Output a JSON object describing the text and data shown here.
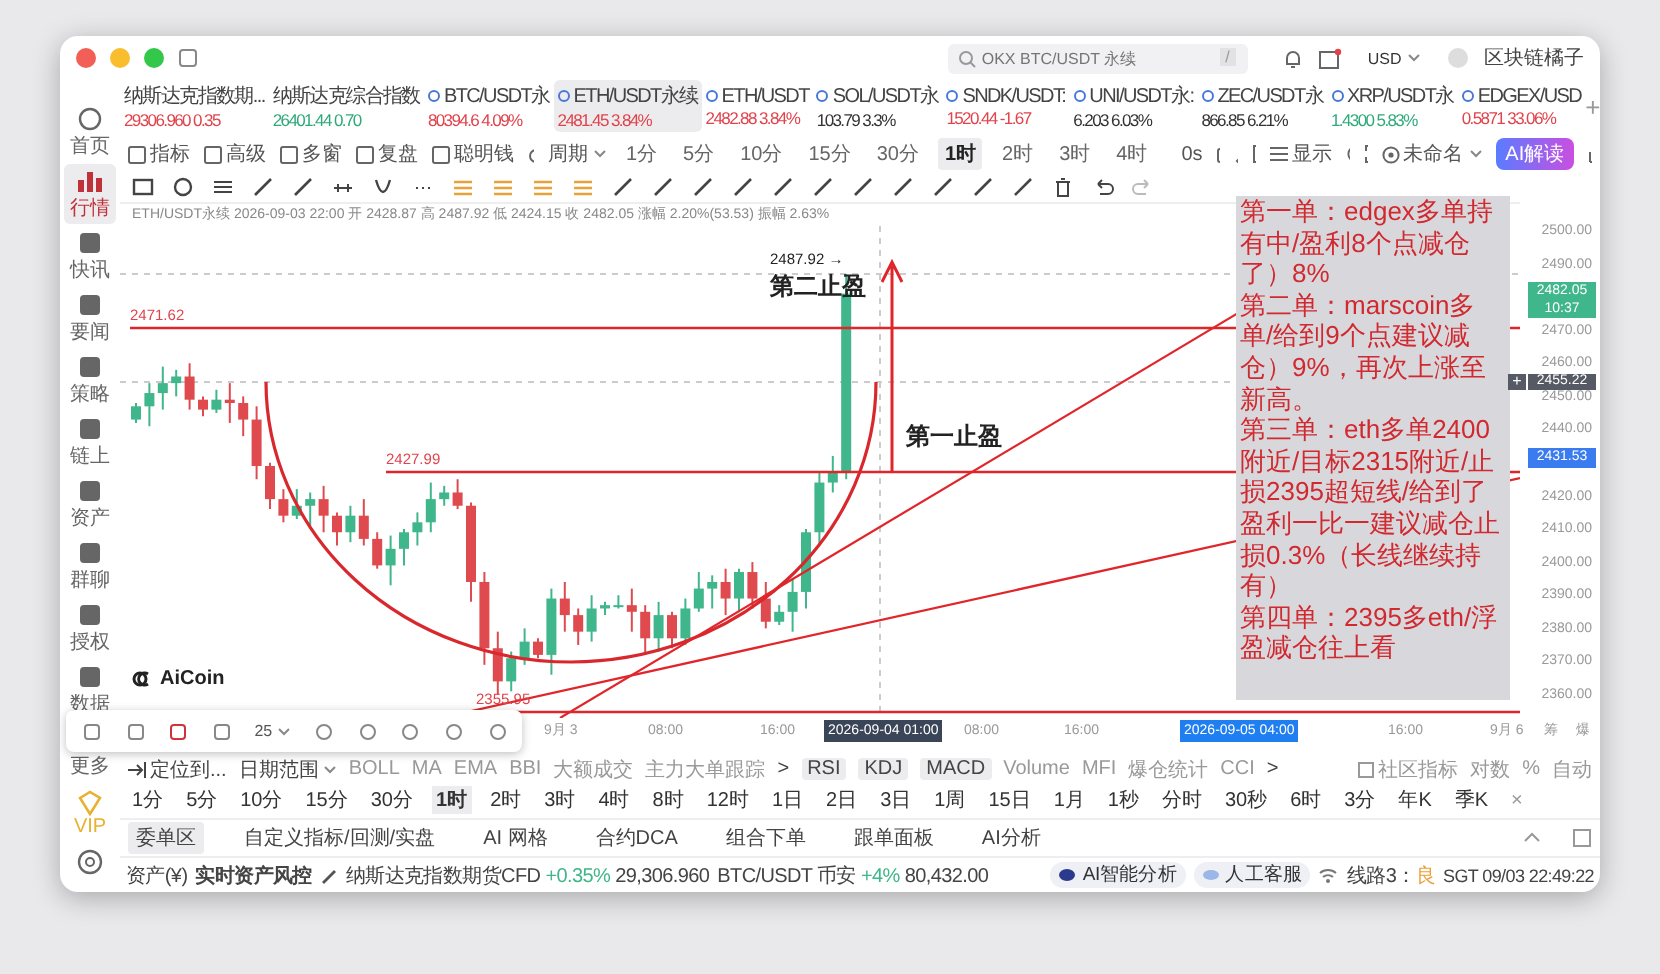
{
  "titlebar": {
    "search_placeholder": "OKX BTC/USDT 永续",
    "search_shortcut": "/",
    "currency": "USD",
    "user": "区块链橘子"
  },
  "sidebar": {
    "items": [
      {
        "kind": "home",
        "label": "首页",
        "selected": false
      },
      {
        "kind": "market",
        "label": "行情",
        "selected": true
      },
      {
        "kind": "flash",
        "label": "快讯",
        "selected": false
      },
      {
        "kind": "news",
        "label": "要闻",
        "selected": false
      },
      {
        "kind": "bot",
        "label": "策略",
        "selected": false
      },
      {
        "kind": "chain",
        "label": "链上",
        "selected": false
      },
      {
        "kind": "wallet",
        "label": "资产",
        "selected": false
      },
      {
        "kind": "chat",
        "label": "群聊",
        "selected": false
      },
      {
        "kind": "auth",
        "label": "授权",
        "selected": false
      },
      {
        "kind": "data",
        "label": "数据",
        "selected": false
      },
      {
        "kind": "more",
        "label": "更多",
        "selected": false
      },
      {
        "kind": "vip",
        "label": "VIP",
        "selected": false
      }
    ]
  },
  "tickers": [
    {
      "name": "纳斯达克指数期...",
      "price": "29306.960",
      "change": "0.35",
      "color": "#e0434b",
      "dot": false,
      "selected": false
    },
    {
      "name": "纳斯达克综合指数",
      "price": "26401.44",
      "change": "0.70",
      "color": "#2fa97c",
      "dot": false,
      "selected": false
    },
    {
      "name": "BTC/USDT永",
      "price": "80394.6",
      "change": "4.09%",
      "color": "#e0434b",
      "dot": true,
      "selected": false
    },
    {
      "name": "ETH/USDT永续",
      "price": "2481.45",
      "change": "3.84%",
      "color": "#e0434b",
      "dot": true,
      "selected": true
    },
    {
      "name": "ETH/USDT",
      "price": "2482.88",
      "change": "3.84%",
      "color": "#e0434b",
      "dot": true,
      "selected": false
    },
    {
      "name": "SOL/USDT永",
      "price": "103.79",
      "change": "3.3%",
      "color": "#333333",
      "dot": true,
      "selected": false
    },
    {
      "name": "SNDK/USDT:",
      "price": "1520.44",
      "change": "-1.67",
      "color": "#e0434b",
      "dot": true,
      "selected": false
    },
    {
      "name": "UNI/USDT永:",
      "price": "6.203",
      "change": "6.03%",
      "color": "#333333",
      "dot": true,
      "selected": false
    },
    {
      "name": "ZEC/USDT永",
      "price": "866.85",
      "change": "6.21%",
      "color": "#333333",
      "dot": true,
      "selected": false
    },
    {
      "name": "XRP/USDT永",
      "price": "1.4300",
      "change": "5.83%",
      "color": "#2fa97c",
      "dot": true,
      "selected": false
    },
    {
      "name": "EDGEX/USD",
      "price": "0.5871",
      "change": "33.06%",
      "color": "#e0434b",
      "dot": true,
      "selected": false
    }
  ],
  "add_ticker": "+",
  "toolbar": {
    "tools": [
      "指标",
      "高级",
      "多窗",
      "复盘",
      "聪明钱"
    ],
    "period_menu": "周期",
    "intervals": [
      {
        "label": "1分",
        "selected": false
      },
      {
        "label": "5分",
        "selected": false
      },
      {
        "label": "10分",
        "selected": false
      },
      {
        "label": "15分",
        "selected": false
      },
      {
        "label": "30分",
        "selected": false
      },
      {
        "label": "1时",
        "selected": true
      },
      {
        "label": "2时",
        "selected": false
      },
      {
        "label": "3时",
        "selected": false
      },
      {
        "label": "4时",
        "selected": false
      }
    ],
    "countdown": "0s",
    "display": "显示",
    "layout_name": "未命名",
    "ai_button": "AI解读"
  },
  "chart": {
    "info": "ETH/USDT永续  2026-09-03 22:00  开 2428.87  高 2487.92  低 2424.15  收 2482.05  涨幅 2.20%(53.53)  振幅 2.63%",
    "price_ticks": [
      "2500.00",
      "2490.00",
      "2470.00",
      "2460.00",
      "2450.00",
      "2440.00",
      "2420.00",
      "2410.00",
      "2400.00",
      "2390.00",
      "2380.00",
      "2370.00",
      "2360.00"
    ],
    "last_price": "2482.05",
    "countdown": "10:37",
    "cursor_price": "2455.22",
    "cursor_add": "+",
    "marked_price": "2431.53",
    "level_labels": [
      "2471.62",
      "2427.99",
      "2355.95"
    ],
    "high_label": "2487.92 →",
    "annotations": [
      "第二止盈",
      "第一止盈"
    ],
    "note": [
      "第一单：edgex多单持有中/盈利8个点减仓了）8%",
      "第二单：marscoin多单/给到9个点建议减仓）9%，再次上涨至新高。",
      "第三单：eth多单2400附近/目标2315附近/止损2395超短线/给到了盈利一比一建议减仓止损0.3%（长线继续持有）",
      "第四单：2395多eth/浮盈减仓往上看"
    ],
    "logo": "AiCoin",
    "time_labels": [
      {
        "text": "9月 3",
        "kind": "plain"
      },
      {
        "text": "08:00",
        "kind": "plain"
      },
      {
        "text": "16:00",
        "kind": "plain"
      },
      {
        "text": "2026-09-04 01:00",
        "kind": "cursor"
      },
      {
        "text": "08:00",
        "kind": "plain"
      },
      {
        "text": "16:00",
        "kind": "plain"
      },
      {
        "text": "2026-09-05 04:00",
        "kind": "marker"
      },
      {
        "text": "16:00",
        "kind": "plain"
      },
      {
        "text": "9月 6",
        "kind": "plain"
      }
    ],
    "axis_buttons": [
      "筹",
      "爆"
    ],
    "float_size": "25"
  },
  "indicators": {
    "locate": "定位到...",
    "date_range": "日期范围",
    "main": [
      "BOLL",
      "MA",
      "EMA",
      "BBI",
      "大额成交",
      "主力大单跟踪"
    ],
    "more": ">",
    "sub": [
      {
        "label": "RSI",
        "selected": true
      },
      {
        "label": "KDJ",
        "selected": true
      },
      {
        "label": "MACD",
        "selected": true
      },
      {
        "label": "Volume",
        "selected": false
      },
      {
        "label": "MFI",
        "selected": false
      },
      {
        "label": "爆仓统计",
        "selected": false
      },
      {
        "label": "CCI",
        "selected": false
      }
    ],
    "sub_more": ">",
    "community": "社区指标",
    "options": [
      "对数",
      "%",
      "自动"
    ]
  },
  "periods": [
    {
      "label": "1分",
      "selected": false
    },
    {
      "label": "5分",
      "selected": false
    },
    {
      "label": "10分",
      "selected": false
    },
    {
      "label": "15分",
      "selected": false
    },
    {
      "label": "30分",
      "selected": false
    },
    {
      "label": "1时",
      "selected": true
    },
    {
      "label": "2时",
      "selected": false
    },
    {
      "label": "3时",
      "selected": false
    },
    {
      "label": "4时",
      "selected": false
    },
    {
      "label": "8时",
      "selected": false
    },
    {
      "label": "12时",
      "selected": false
    },
    {
      "label": "1日",
      "selected": false
    },
    {
      "label": "2日",
      "selected": false
    },
    {
      "label": "3日",
      "selected": false
    },
    {
      "label": "1周",
      "selected": false
    },
    {
      "label": "15日",
      "selected": false
    },
    {
      "label": "1月",
      "selected": false
    },
    {
      "label": "1秒",
      "selected": false
    },
    {
      "label": "分时",
      "selected": false
    },
    {
      "label": "30秒",
      "selected": false
    },
    {
      "label": "6时",
      "selected": false
    },
    {
      "label": "3分",
      "selected": false
    },
    {
      "label": "年K",
      "selected": false
    },
    {
      "label": "季K",
      "selected": false
    }
  ],
  "periods_close": "×",
  "panel_tabs": [
    {
      "label": "委单区",
      "selected": true
    },
    {
      "label": "自定义指标/回测/实盘",
      "selected": false
    },
    {
      "label": "AI 网格",
      "selected": false
    },
    {
      "label": "合约DCA",
      "selected": false
    },
    {
      "label": "组合下单",
      "selected": false
    },
    {
      "label": "跟单面板",
      "selected": false
    },
    {
      "label": "AI分析",
      "selected": false
    }
  ],
  "status_bar": {
    "assets": "资产(¥)",
    "risk": "实时资产风控",
    "quotes": [
      {
        "name": "纳斯达克指数期货CFD",
        "change": "+0.35%",
        "price": "29,306.960"
      },
      {
        "name": "BTC/USDT 币安",
        "change": "+4%",
        "price": "80,432.00"
      }
    ],
    "ai": "AI智能分析",
    "support": "人工客服",
    "line": "线路3：",
    "line_quality": "良",
    "clock": "SGT 09/03 22:49:22"
  }
}
